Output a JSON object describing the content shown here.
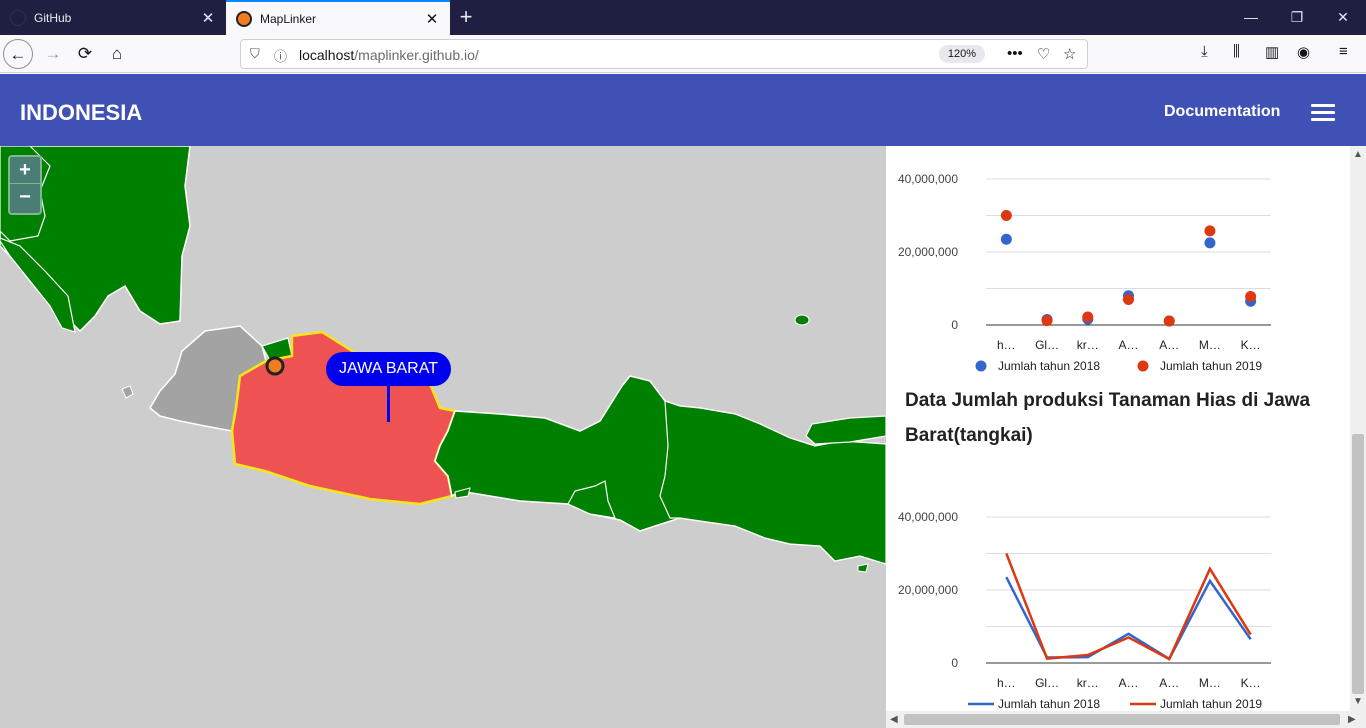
{
  "browser": {
    "tabs": [
      {
        "title": "GitHub",
        "close": "✕"
      },
      {
        "title": "MapLinker",
        "close": "✕"
      }
    ],
    "new_tab": "+",
    "window_controls": [
      "—",
      "❐",
      "✕"
    ],
    "url_host": "localhost",
    "url_path": "/maplinker.github.io/",
    "zoom": "120%"
  },
  "header": {
    "title": "INDONESIA",
    "documentation": "Documentation"
  },
  "map": {
    "zoom_in": "+",
    "zoom_out": "−",
    "selected_region": "JAWA BARAT",
    "colors": {
      "sea": "#cdcdcd",
      "province": "#008000",
      "selected": "#ee5253",
      "other": "#a3a3a3",
      "label": "#0000ee"
    }
  },
  "panel": {
    "heading": "Data Jumlah produksi Tanaman Hias di Jawa Barat(tangkai)"
  },
  "chart_data": [
    {
      "type": "scatter",
      "categories": [
        "h…",
        "Gl…",
        "kr…",
        "A…",
        "A…",
        "M…",
        "K…"
      ],
      "y_ticks": [
        "40,000,000",
        "20,000,000",
        "0"
      ],
      "ylim": [
        0,
        40000000
      ],
      "series": [
        {
          "name": "Jumlah tahun 2018",
          "color": "#3366cc",
          "values": [
            23500000,
            1500000,
            1600000,
            8000000,
            1100000,
            22500000,
            6500000
          ]
        },
        {
          "name": "Jumlah tahun 2019",
          "color": "#dc3912",
          "values": [
            30000000,
            1200000,
            2200000,
            7000000,
            1100000,
            25800000,
            7800000
          ]
        }
      ],
      "legend": "bottom"
    },
    {
      "type": "line",
      "categories": [
        "h…",
        "Gl…",
        "kr…",
        "A…",
        "A…",
        "M…",
        "K…"
      ],
      "y_ticks": [
        "40,000,000",
        "20,000,000",
        "0"
      ],
      "ylim": [
        0,
        40000000
      ],
      "series": [
        {
          "name": "Jumlah tahun 2018",
          "color": "#3366cc",
          "values": [
            23500000,
            1500000,
            1600000,
            8000000,
            1100000,
            22500000,
            6500000
          ]
        },
        {
          "name": "Jumlah tahun 2019",
          "color": "#dc3912",
          "values": [
            30000000,
            1200000,
            2200000,
            7000000,
            1100000,
            25800000,
            7800000
          ]
        }
      ],
      "legend": "bottom"
    }
  ]
}
